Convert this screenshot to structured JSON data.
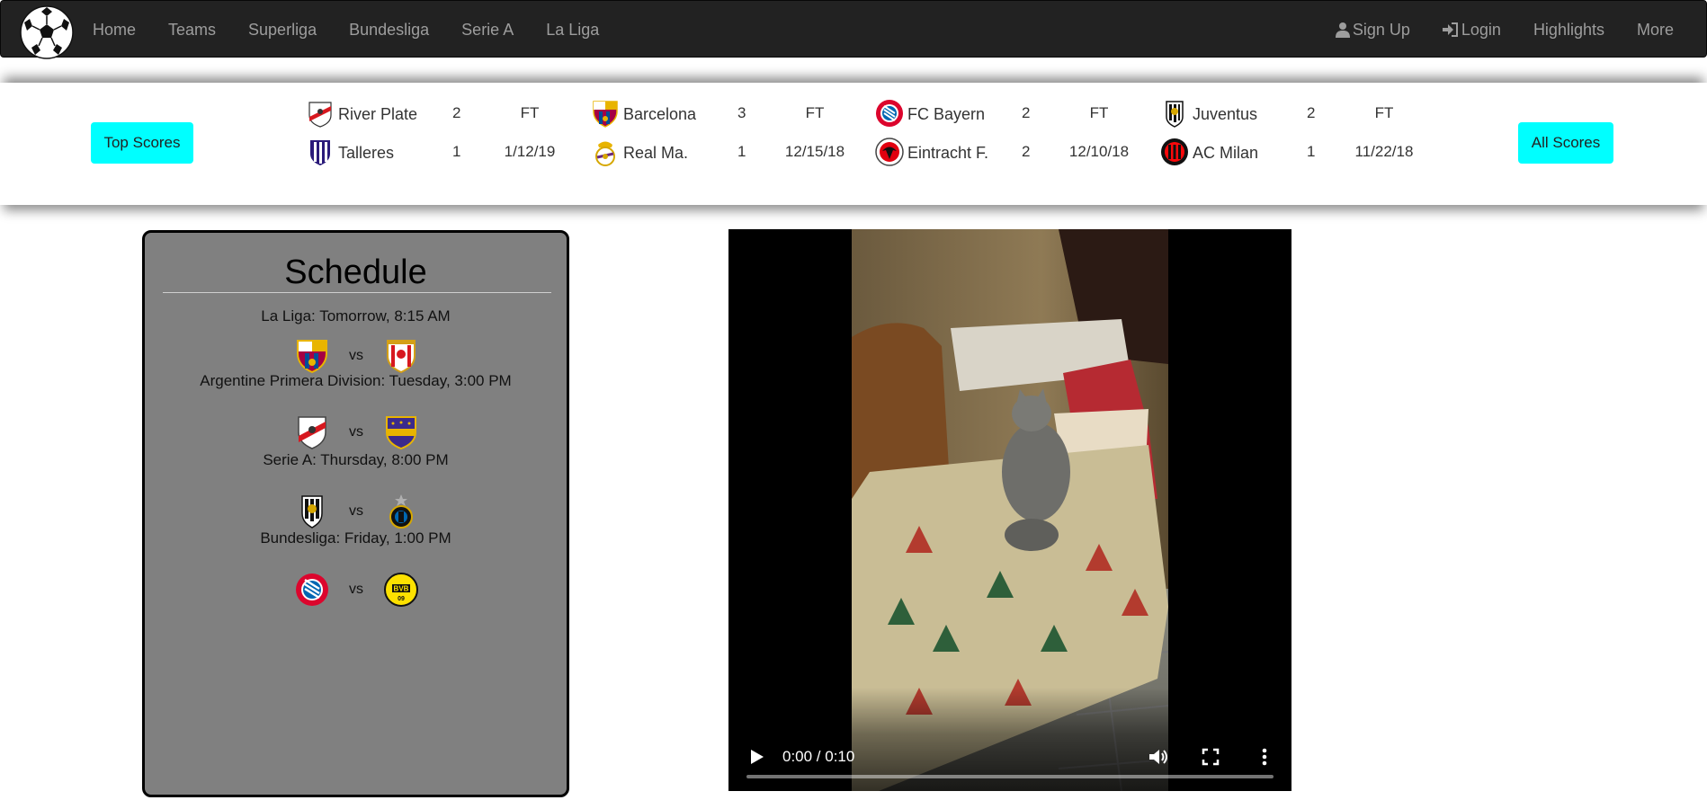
{
  "navbar": {
    "left_links": [
      "Home",
      "Teams",
      "Superliga",
      "Bundesliga",
      "Serie A",
      "La Liga"
    ],
    "signup": "Sign Up",
    "login": "Login",
    "highlights": "Highlights",
    "more": "More"
  },
  "scores": {
    "top_scores_label": "Top Scores",
    "all_scores_label": "All Scores",
    "matches": [
      {
        "home": "River Plate",
        "home_score": "2",
        "away": "Talleres",
        "away_score": "1",
        "status": "FT",
        "date": "1/12/19"
      },
      {
        "home": "Barcelona",
        "home_score": "3",
        "away": "Real Ma.",
        "away_score": "1",
        "status": "FT",
        "date": "12/15/18"
      },
      {
        "home": "FC Bayern",
        "home_score": "2",
        "away": "Eintracht F.",
        "away_score": "2",
        "status": "FT",
        "date": "12/10/18"
      },
      {
        "home": "Juventus",
        "home_score": "2",
        "away": "AC Milan",
        "away_score": "1",
        "status": "FT",
        "date": "11/22/18"
      }
    ]
  },
  "schedule": {
    "title": "Schedule",
    "games": [
      {
        "title": "La Liga: Tomorrow, 8:15 AM",
        "vs": "vs"
      },
      {
        "title": "Argentine Primera Division: Tuesday, 3:00 PM",
        "vs": "vs"
      },
      {
        "title": "Serie A: Thursday, 8:00 PM",
        "vs": "vs"
      },
      {
        "title": "Bundesliga: Friday, 1:00 PM",
        "vs": "vs"
      }
    ]
  },
  "video": {
    "time": "0:00 / 0:10",
    "progress": 0
  },
  "colors": {
    "navbar_bg": "#222222",
    "nav_link": "#9d9d9d",
    "button_cyan": "#00ffff",
    "schedule_bg": "#808080"
  }
}
